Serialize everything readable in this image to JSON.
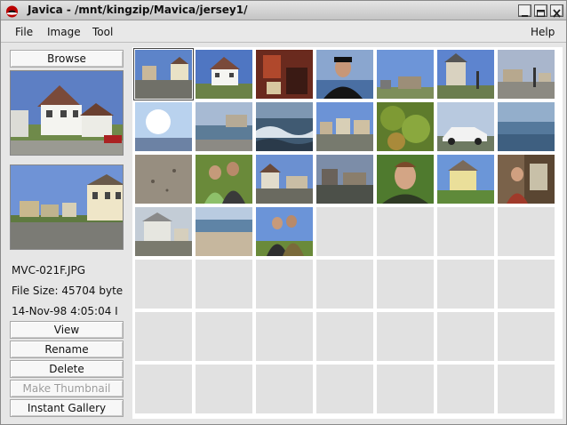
{
  "window": {
    "title": "Javica - /mnt/kingzip/Mavica/jersey1/",
    "titlebar_color": "#d0d0d0",
    "buttons": [
      "minimize-icon",
      "maximize-icon",
      "close-icon"
    ]
  },
  "menu": {
    "file": "File",
    "image": "Image",
    "tool": "Tool",
    "help": "Help"
  },
  "sidebar": {
    "browse_label": "Browse",
    "file_name": "MVC-021F.JPG",
    "file_size": "File Size: 45704 byte",
    "file_date": "14-Nov-98 4:05:04 I",
    "view_label": "View",
    "rename_label": "Rename",
    "delete_label": "Delete",
    "make_thumbnail_label": "Make Thumbnail",
    "make_thumbnail_enabled": false,
    "instant_gallery_label": "Instant Gallery"
  },
  "gallery": {
    "columns": 7,
    "rows": 7,
    "selected_index": 0,
    "thumbnails": [
      "street-houses",
      "white-house",
      "interior-room",
      "man-portrait",
      "sky-building",
      "house-street",
      "lamp-street",
      "sun-glare",
      "beach-boardwalk",
      "ocean-waves",
      "row-houses",
      "green-trees",
      "white-car",
      "ocean-water",
      "sand-closeup",
      "couple-portrait",
      "houses-street",
      "dark-houses",
      "man-closeup",
      "yellow-house",
      "people-indoor",
      "grey-house",
      "beach-shore",
      "couple-outdoor"
    ],
    "empty_slot_color": "#e1e1e1"
  }
}
